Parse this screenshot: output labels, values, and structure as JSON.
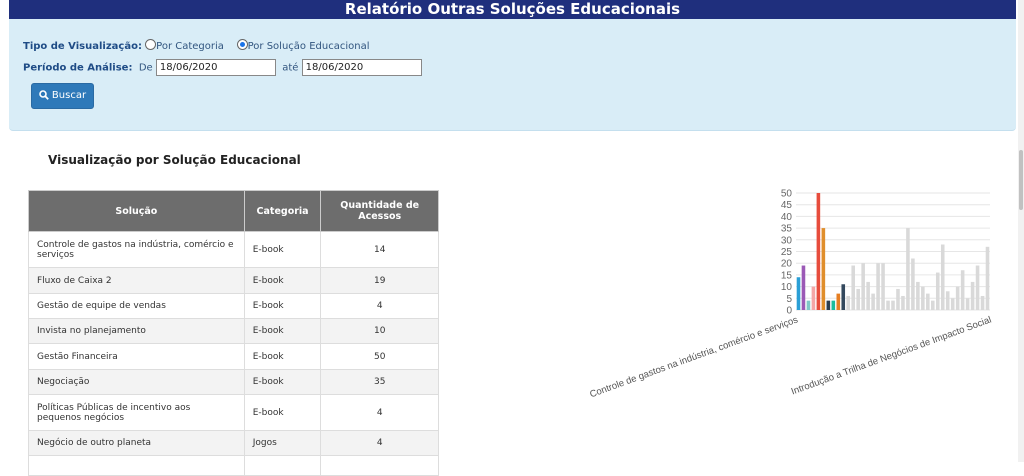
{
  "header": {
    "title": "Relatório Outras Soluções Educacionais"
  },
  "filters": {
    "view_type_label": "Tipo de Visualização:",
    "option_category": "Por Categoria",
    "option_solution": "Por Solução Educacional",
    "selected": "Por Solução Educacional",
    "period_label": "Período de Análise:",
    "from_label": "De",
    "from_value": "18/06/2020",
    "to_label": "até",
    "to_value": "18/06/2020",
    "search_button": "Buscar"
  },
  "section": {
    "title": "Visualização por Solução Educacional"
  },
  "table": {
    "columns": [
      "Solução",
      "Categoria",
      "Quantidade de Acessos"
    ],
    "rows": [
      [
        "Controle de gastos na indústria, comércio e serviços",
        "E-book",
        "14"
      ],
      [
        "Fluxo de Caixa 2",
        "E-book",
        "19"
      ],
      [
        "Gestão de equipe de vendas",
        "E-book",
        "4"
      ],
      [
        "Invista no planejamento",
        "E-book",
        "10"
      ],
      [
        "Gestão Financeira",
        "E-book",
        "50"
      ],
      [
        "Negociação",
        "E-book",
        "35"
      ],
      [
        "Políticas Públicas de incentivo aos pequenos negócios",
        "E-book",
        "4"
      ],
      [
        "Negócio de outro planeta",
        "Jogos",
        "4"
      ]
    ]
  },
  "chart_data": {
    "type": "bar",
    "yticks": [
      "50",
      "45",
      "40",
      "35",
      "30",
      "25",
      "20",
      "15",
      "10",
      "5",
      "0"
    ],
    "ylim": [
      0,
      50
    ],
    "x_labels_shown": [
      "Controle de gastos na indústria, comércio e serviços",
      "Introdução a Trilha de Negócios de Impacto Social"
    ],
    "values": [
      14,
      19,
      4,
      10,
      50,
      35,
      4,
      4,
      7,
      11,
      6,
      19,
      9,
      20,
      12,
      7,
      20,
      20,
      4,
      4,
      9,
      6,
      35,
      22,
      12,
      10,
      7,
      4,
      16,
      28,
      8,
      5,
      10,
      17,
      5,
      12,
      19,
      6,
      27
    ],
    "colors": [
      "#2a9fd6",
      "#9b59b6",
      "#7ec8c8",
      "#f4a6a6",
      "#e74c3c",
      "#e08e2b",
      "#2c3e50",
      "#1abc9c",
      "#e67e22",
      "#34495e"
    ],
    "inactive_color": "#d9d9d9"
  }
}
